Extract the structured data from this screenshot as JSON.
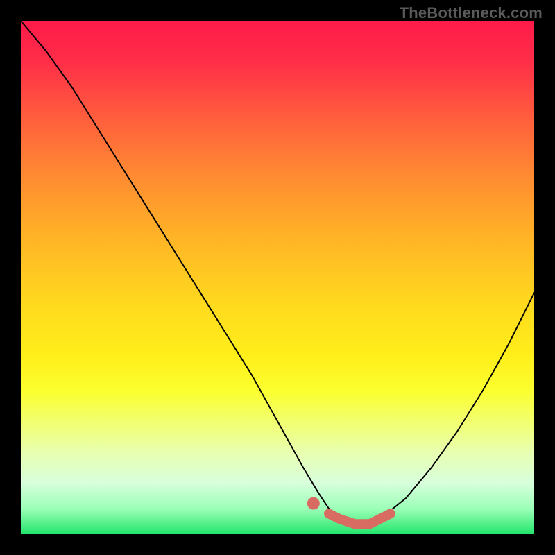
{
  "watermark": "TheBottleneck.com",
  "colors": {
    "curve": "#000000",
    "highlight": "#d96c62",
    "background_top": "#ff1a4a",
    "background_bottom": "#22e56a",
    "page_bg": "#000000"
  },
  "chart_data": {
    "type": "line",
    "title": "",
    "xlabel": "",
    "ylabel": "",
    "xlim": [
      0,
      100
    ],
    "ylim": [
      0,
      100
    ],
    "grid": false,
    "legend": false,
    "series": [
      {
        "name": "bottleneck_curve",
        "x": [
          0,
          5,
          10,
          15,
          20,
          25,
          30,
          35,
          40,
          45,
          50,
          55,
          58,
          60,
          62,
          65,
          68,
          70,
          75,
          80,
          85,
          90,
          95,
          100
        ],
        "y": [
          100,
          94,
          87,
          79,
          71,
          63,
          55,
          47,
          39,
          31,
          22,
          13,
          8,
          5,
          3,
          2,
          2,
          3,
          7,
          13,
          20,
          28,
          37,
          47
        ]
      }
    ],
    "highlight": {
      "dot_x": 57,
      "dot_y": 6,
      "segment_x": [
        60,
        62,
        65,
        68,
        70,
        72
      ],
      "segment_y": [
        4,
        3,
        2,
        2,
        3,
        4
      ]
    },
    "gradient_stops": [
      {
        "pct": 0,
        "color": "#ff1a4a"
      },
      {
        "pct": 8,
        "color": "#ff2e48"
      },
      {
        "pct": 18,
        "color": "#ff5a3e"
      },
      {
        "pct": 30,
        "color": "#ff8a32"
      },
      {
        "pct": 42,
        "color": "#ffb326"
      },
      {
        "pct": 55,
        "color": "#ffd91e"
      },
      {
        "pct": 65,
        "color": "#ffee1a"
      },
      {
        "pct": 72,
        "color": "#fbff2e"
      },
      {
        "pct": 78,
        "color": "#f2ff6e"
      },
      {
        "pct": 84,
        "color": "#e8ffb0"
      },
      {
        "pct": 90,
        "color": "#d8ffdc"
      },
      {
        "pct": 95,
        "color": "#9cffb8"
      },
      {
        "pct": 100,
        "color": "#22e56a"
      }
    ]
  }
}
